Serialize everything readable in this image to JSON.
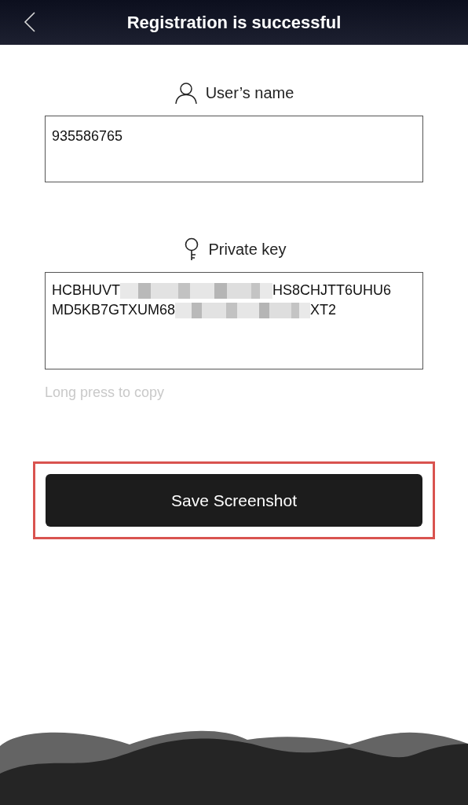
{
  "header": {
    "title": "Registration is successful"
  },
  "username": {
    "label": "User’s name",
    "value": "935586765"
  },
  "private_key": {
    "label": "Private key",
    "lines": [
      [
        {
          "kind": "text",
          "text": "HCBHUVT"
        },
        {
          "kind": "redacted"
        },
        {
          "kind": "text",
          "text": "HS8CHJTT6UHU6"
        }
      ],
      [
        {
          "kind": "text",
          "text": "MD5KB7GTXUM68"
        },
        {
          "kind": "redacted"
        },
        {
          "kind": "text",
          "text": "XT2"
        }
      ]
    ],
    "hint": "Long press to copy"
  },
  "save_button": {
    "label": "Save Screenshot",
    "highlighted": true
  }
}
